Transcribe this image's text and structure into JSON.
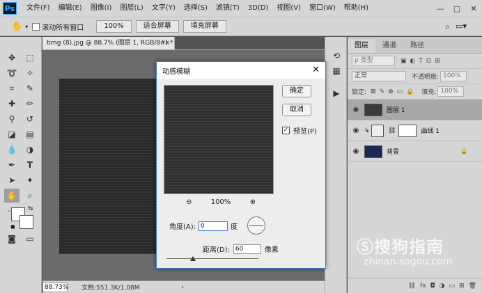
{
  "app": {
    "logo": "Ps"
  },
  "menubar": {
    "items": [
      "文件(F)",
      "编辑(E)",
      "图像(I)",
      "图层(L)",
      "文字(Y)",
      "选择(S)",
      "滤镜(T)",
      "3D(D)",
      "视图(V)",
      "窗口(W)",
      "帮助(H)"
    ]
  },
  "window": {
    "minimize": "—",
    "maximize": "▢",
    "close": "✕"
  },
  "options": {
    "scroll_all_label": "滚动所有窗口",
    "zoom_value": "100%",
    "fit_screen": "适合屏幕",
    "fill_screen": "填充屏幕"
  },
  "document": {
    "tab_title": "timg (8).jpg @ 88.7% (图层 1, RGB/8#) *",
    "tab_close": "×",
    "zoom": "88.73%",
    "doc_info": "文档:551.3K/1.08M",
    "arrow": "›"
  },
  "layers_panel": {
    "tabs": [
      "图层",
      "通道",
      "路径"
    ],
    "filter_placeholder": "ρ 类型",
    "blend_mode": "正常",
    "opacity_label": "不透明度:",
    "opacity_value": "100%",
    "lock_label": "锁定:",
    "fill_label": "填充:",
    "fill_value": "100%",
    "layers": [
      {
        "name": "图层 1",
        "selected": true
      },
      {
        "name": "曲线 1",
        "selected": false
      },
      {
        "name": "背景",
        "selected": false
      }
    ]
  },
  "dialog": {
    "title": "动感模糊",
    "ok": "确定",
    "cancel": "取消",
    "preview_label": "预览(P)",
    "zoom_out": "⊖",
    "zoom_value": "100%",
    "zoom_in": "⊕",
    "angle_label": "角度(A):",
    "angle_value": "0",
    "angle_unit": "度",
    "distance_label": "距离(D):",
    "distance_value": "60",
    "distance_unit": "像素"
  },
  "watermark": {
    "brand": "Ⓢ搜狗指南",
    "url": "zhinan.sogou.com"
  }
}
